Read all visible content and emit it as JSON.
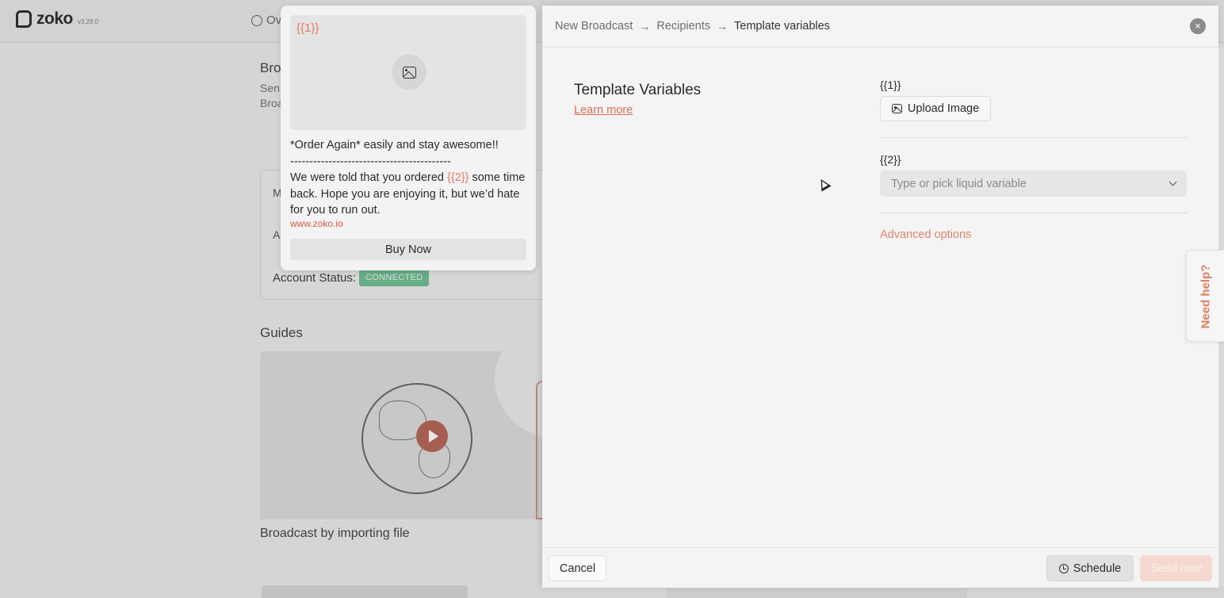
{
  "app": {
    "name": "zoko",
    "version": "v3.29.0"
  },
  "background": {
    "nav_tab_label": "Ov",
    "page_title": "Bro",
    "subtitle_line1": "Sen",
    "subtitle_line2": "Broa",
    "card_line1": "M",
    "card_line2": "A",
    "account_status_label": "Account Status:",
    "account_status_badge": "CONNECTED",
    "guides_title": "Guides",
    "guide_caption": "Broadcast by importing file"
  },
  "preview": {
    "media_variable": "{{1}}",
    "line1": "*Order Again* easily and stay awesome!!",
    "separator": "------------------------------------------",
    "body_before": "We were told that you ordered ",
    "body_variable": "{{2}}",
    "body_after": " some time back. Hope you are enjoying it, but we’d hate for you to run out.",
    "link": "www.zoko.io",
    "cta": "Buy Now"
  },
  "drawer": {
    "breadcrumb": [
      "New Broadcast",
      "Recipients",
      "Template variables"
    ],
    "breadcrumb_separator": "→",
    "close_glyph": "×",
    "section_title": "Template Variables",
    "learn_more": "Learn more",
    "variables": [
      {
        "label": "{{1}}",
        "action": "Upload Image"
      },
      {
        "label": "{{2}}",
        "placeholder": "Type or pick liquid variable"
      }
    ],
    "advanced": "Advanced options",
    "footer": {
      "cancel": "Cancel",
      "schedule": "Schedule",
      "send": "Send now"
    }
  },
  "help": {
    "label": "Need help?"
  },
  "colors": {
    "accent": "#e07e62",
    "badge_green": "#63b98a",
    "send_disabled": "#f5d9d1"
  }
}
